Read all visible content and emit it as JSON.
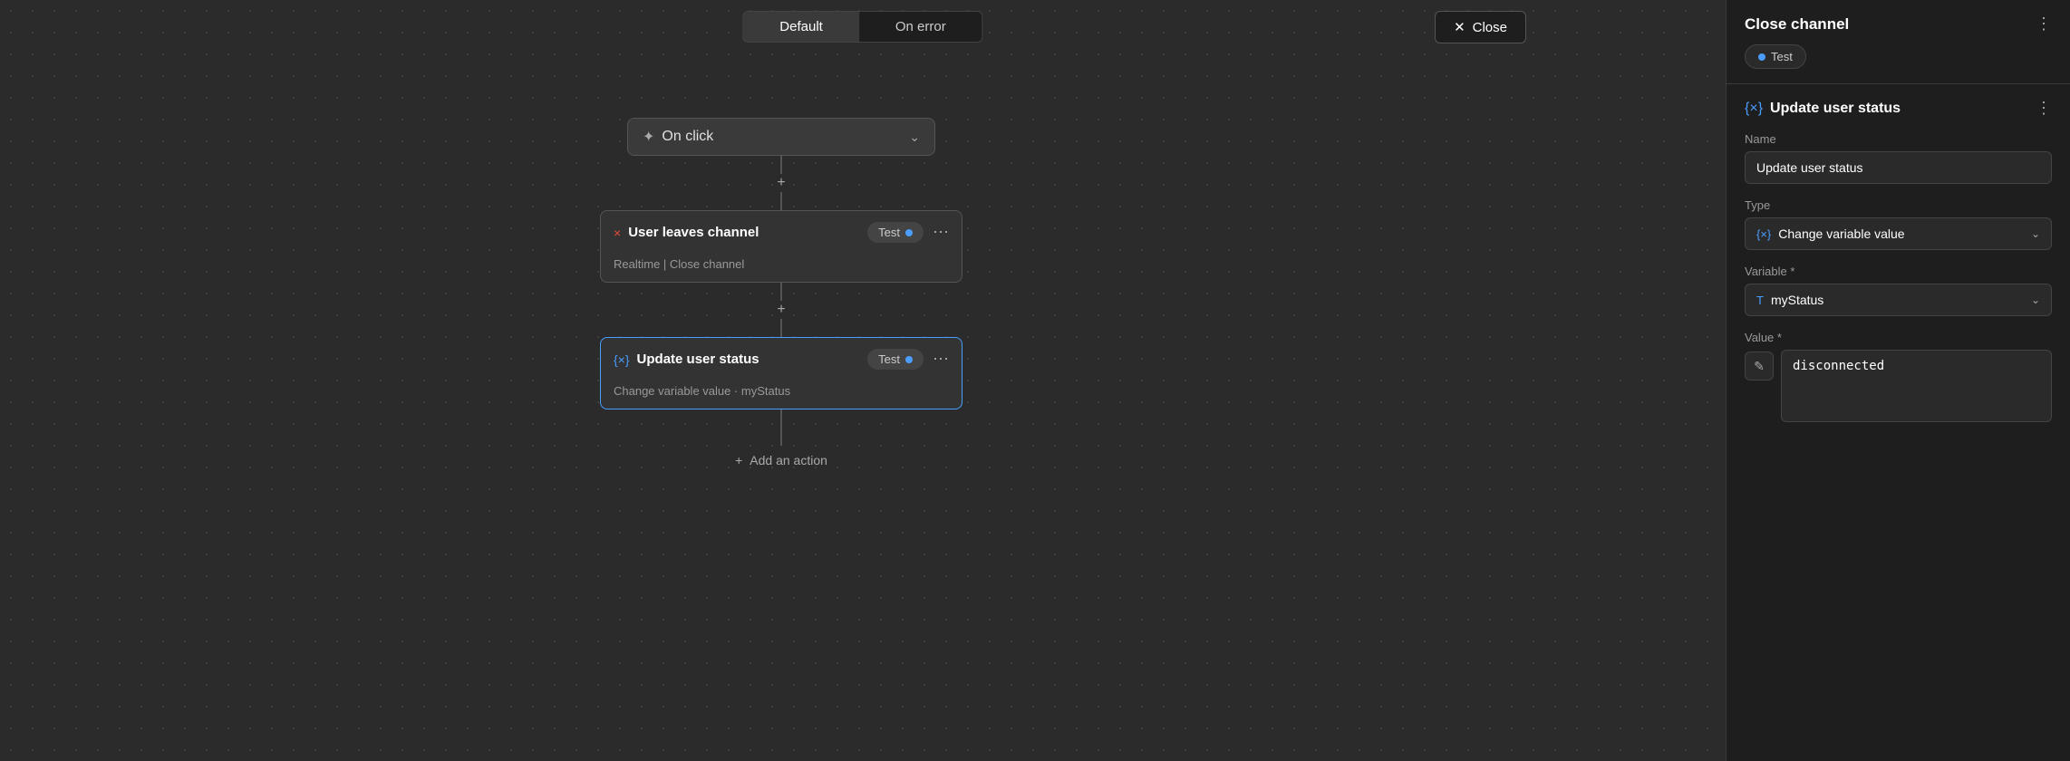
{
  "tabs": {
    "default_label": "Default",
    "on_error_label": "On error"
  },
  "close_button_label": "Close",
  "trigger": {
    "label": "On click"
  },
  "node_close_channel": {
    "icon": "×",
    "title": "User leaves channel",
    "subtitle": "Realtime | Close channel",
    "test_label": "Test",
    "more_icon": "⋯"
  },
  "node_update_status": {
    "icon": "{×}",
    "title": "Update user status",
    "subtitle": "Change variable value · myStatus",
    "test_label": "Test",
    "more_icon": "⋯"
  },
  "add_action_label": "Add an action",
  "right_panel": {
    "close_channel_title": "Close channel",
    "close_channel_test_label": "Test",
    "more_icon": "⋮",
    "update_status": {
      "icon": "{×}",
      "title": "Update user status",
      "more_icon": "⋮",
      "name_label": "Name",
      "name_value": "Update user status",
      "type_label": "Type",
      "type_value": "Change variable value",
      "type_icon": "{×}",
      "variable_label": "Variable *",
      "variable_value": "myStatus",
      "variable_icon": "T",
      "value_label": "Value *",
      "value_value": "disconnected",
      "value_icon": "✎"
    }
  }
}
